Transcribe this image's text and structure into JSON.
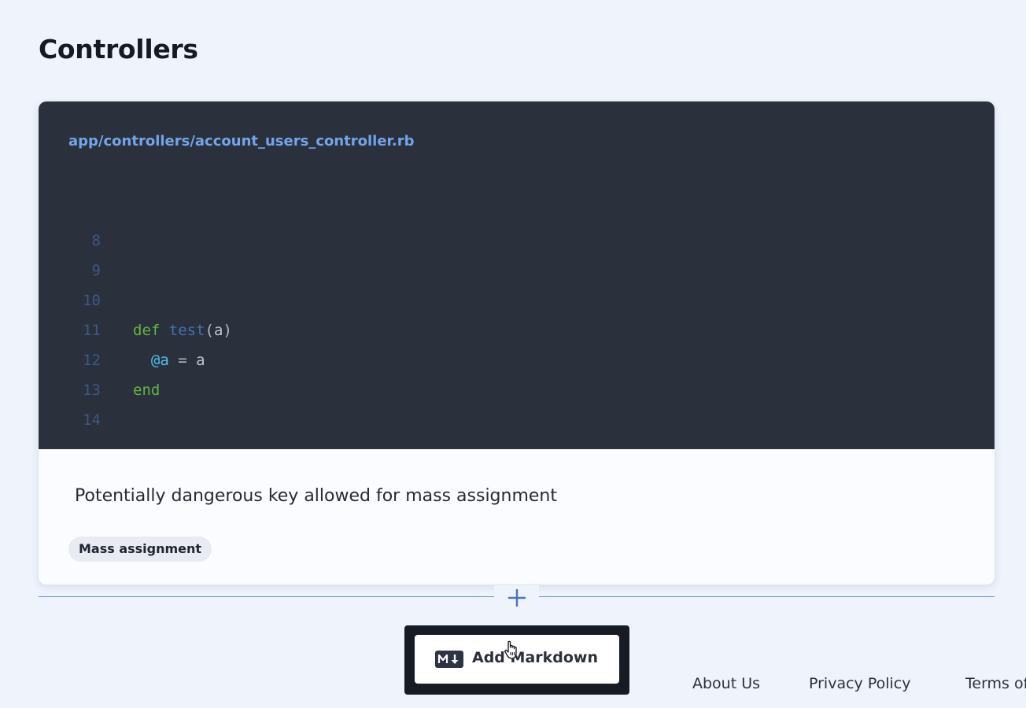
{
  "section": {
    "title": "Controllers"
  },
  "code": {
    "file_path": "app/controllers/account_users_controller.rb",
    "lines": [
      {
        "number": "8",
        "code": ""
      },
      {
        "number": "9",
        "code": ""
      },
      {
        "number": "10",
        "code": "def test(a)"
      },
      {
        "number": "11",
        "code": "  @a = a"
      },
      {
        "number": "12",
        "code": "end"
      },
      {
        "number": "13",
        "code": ""
      },
      {
        "number": "14",
        "code": ""
      }
    ]
  },
  "finding": {
    "description": "Potentially dangerous key allowed for mass assignment",
    "tag": "Mass assignment"
  },
  "add_block": {
    "icon": "plus-icon"
  },
  "menu": {
    "item_label": "Add Markdown",
    "item_icon": "markdown-icon"
  },
  "footer": {
    "links": [
      "About Us",
      "Privacy Policy",
      "Terms of Use"
    ]
  },
  "colors": {
    "background": "#eef3fc",
    "code_background": "#2b303d",
    "file_path": "#73a5ea",
    "keyword": "#64b53d",
    "method": "#456fb5",
    "instance_variable": "#4cc3eb",
    "line_number": "#3d5884",
    "divider": "#6b95d6"
  }
}
